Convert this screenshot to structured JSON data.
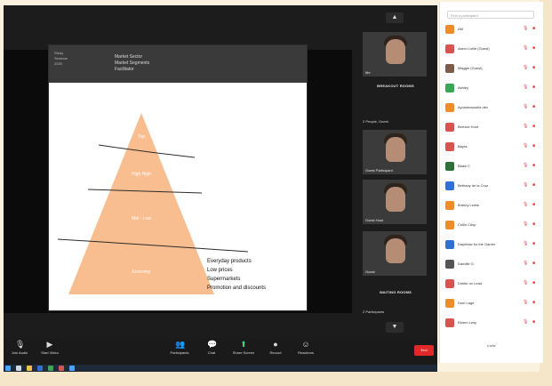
{
  "slide": {
    "logo_lines": [
      "Study",
      "Seminar",
      "2020"
    ],
    "title_lines": [
      "Market Sector",
      "Market Segments",
      "Facilitator"
    ],
    "pyramid_notes": [
      "Everyday products",
      "Low prices",
      "Supermarkets",
      "Promotion and discounts"
    ],
    "level_text": [
      "Top",
      "High High",
      "Mid - Low",
      "Economy"
    ]
  },
  "strip": {
    "top_caption": "Me",
    "group1_label": "BREAKOUT ROOMS",
    "group1_small": "2 People, Guest",
    "tiles": [
      {
        "caption": "Guest Participant"
      },
      {
        "caption": "Guest Host"
      },
      {
        "caption": "Guest"
      }
    ],
    "group2_label": "WAITING ROOMS",
    "group2_small": "2 Participants"
  },
  "toolbar": {
    "items": [
      {
        "icon": "microphone-icon",
        "label": "Join Audio"
      },
      {
        "icon": "video-icon",
        "label": "Start Video"
      },
      {
        "icon": "participants-icon",
        "label": "Participants"
      },
      {
        "icon": "chat-icon",
        "label": "Chat"
      },
      {
        "icon": "share-screen-icon",
        "label": "Share Screen"
      },
      {
        "icon": "record-icon",
        "label": "Record"
      },
      {
        "icon": "reactions-icon",
        "label": "Reactions"
      }
    ],
    "end_label": "End"
  },
  "panel": {
    "search_placeholder": "Find a participant",
    "participants": [
      {
        "name": "AM",
        "color": "#f28c28"
      },
      {
        "name": "Aaron Lullie (Guest)",
        "color": "#d9534f"
      },
      {
        "name": "Maggie (Guest)",
        "color": "#7b5e4a"
      },
      {
        "name": "Ashley",
        "color": "#3aa757"
      },
      {
        "name": "Ayushmanuela dev",
        "color": "#f28c28"
      },
      {
        "name": "Bernice Hunt",
        "color": "#d9534f"
      },
      {
        "name": "Bayra",
        "color": "#d9534f"
      },
      {
        "name": "Blake C",
        "color": "#2e6f3a"
      },
      {
        "name": "Bethany de la Cruz",
        "color": "#2f6fd6"
      },
      {
        "name": "Britney Lewis",
        "color": "#f28c28"
      },
      {
        "name": "Collin Crisp",
        "color": "#f28c28"
      },
      {
        "name": "Dayshaw for the Gamer",
        "color": "#2f6fd6"
      },
      {
        "name": "Dandile G",
        "color": "#555555"
      },
      {
        "name": "Dobile on Lead",
        "color": "#d9534f"
      },
      {
        "name": "Dom Lage",
        "color": "#f28c28"
      },
      {
        "name": "Ekrem Lesy",
        "color": "#d9534f"
      }
    ],
    "footer": "Invite"
  },
  "colors": {
    "pyramid": "#f9be8f",
    "end_button": "#e02828"
  }
}
